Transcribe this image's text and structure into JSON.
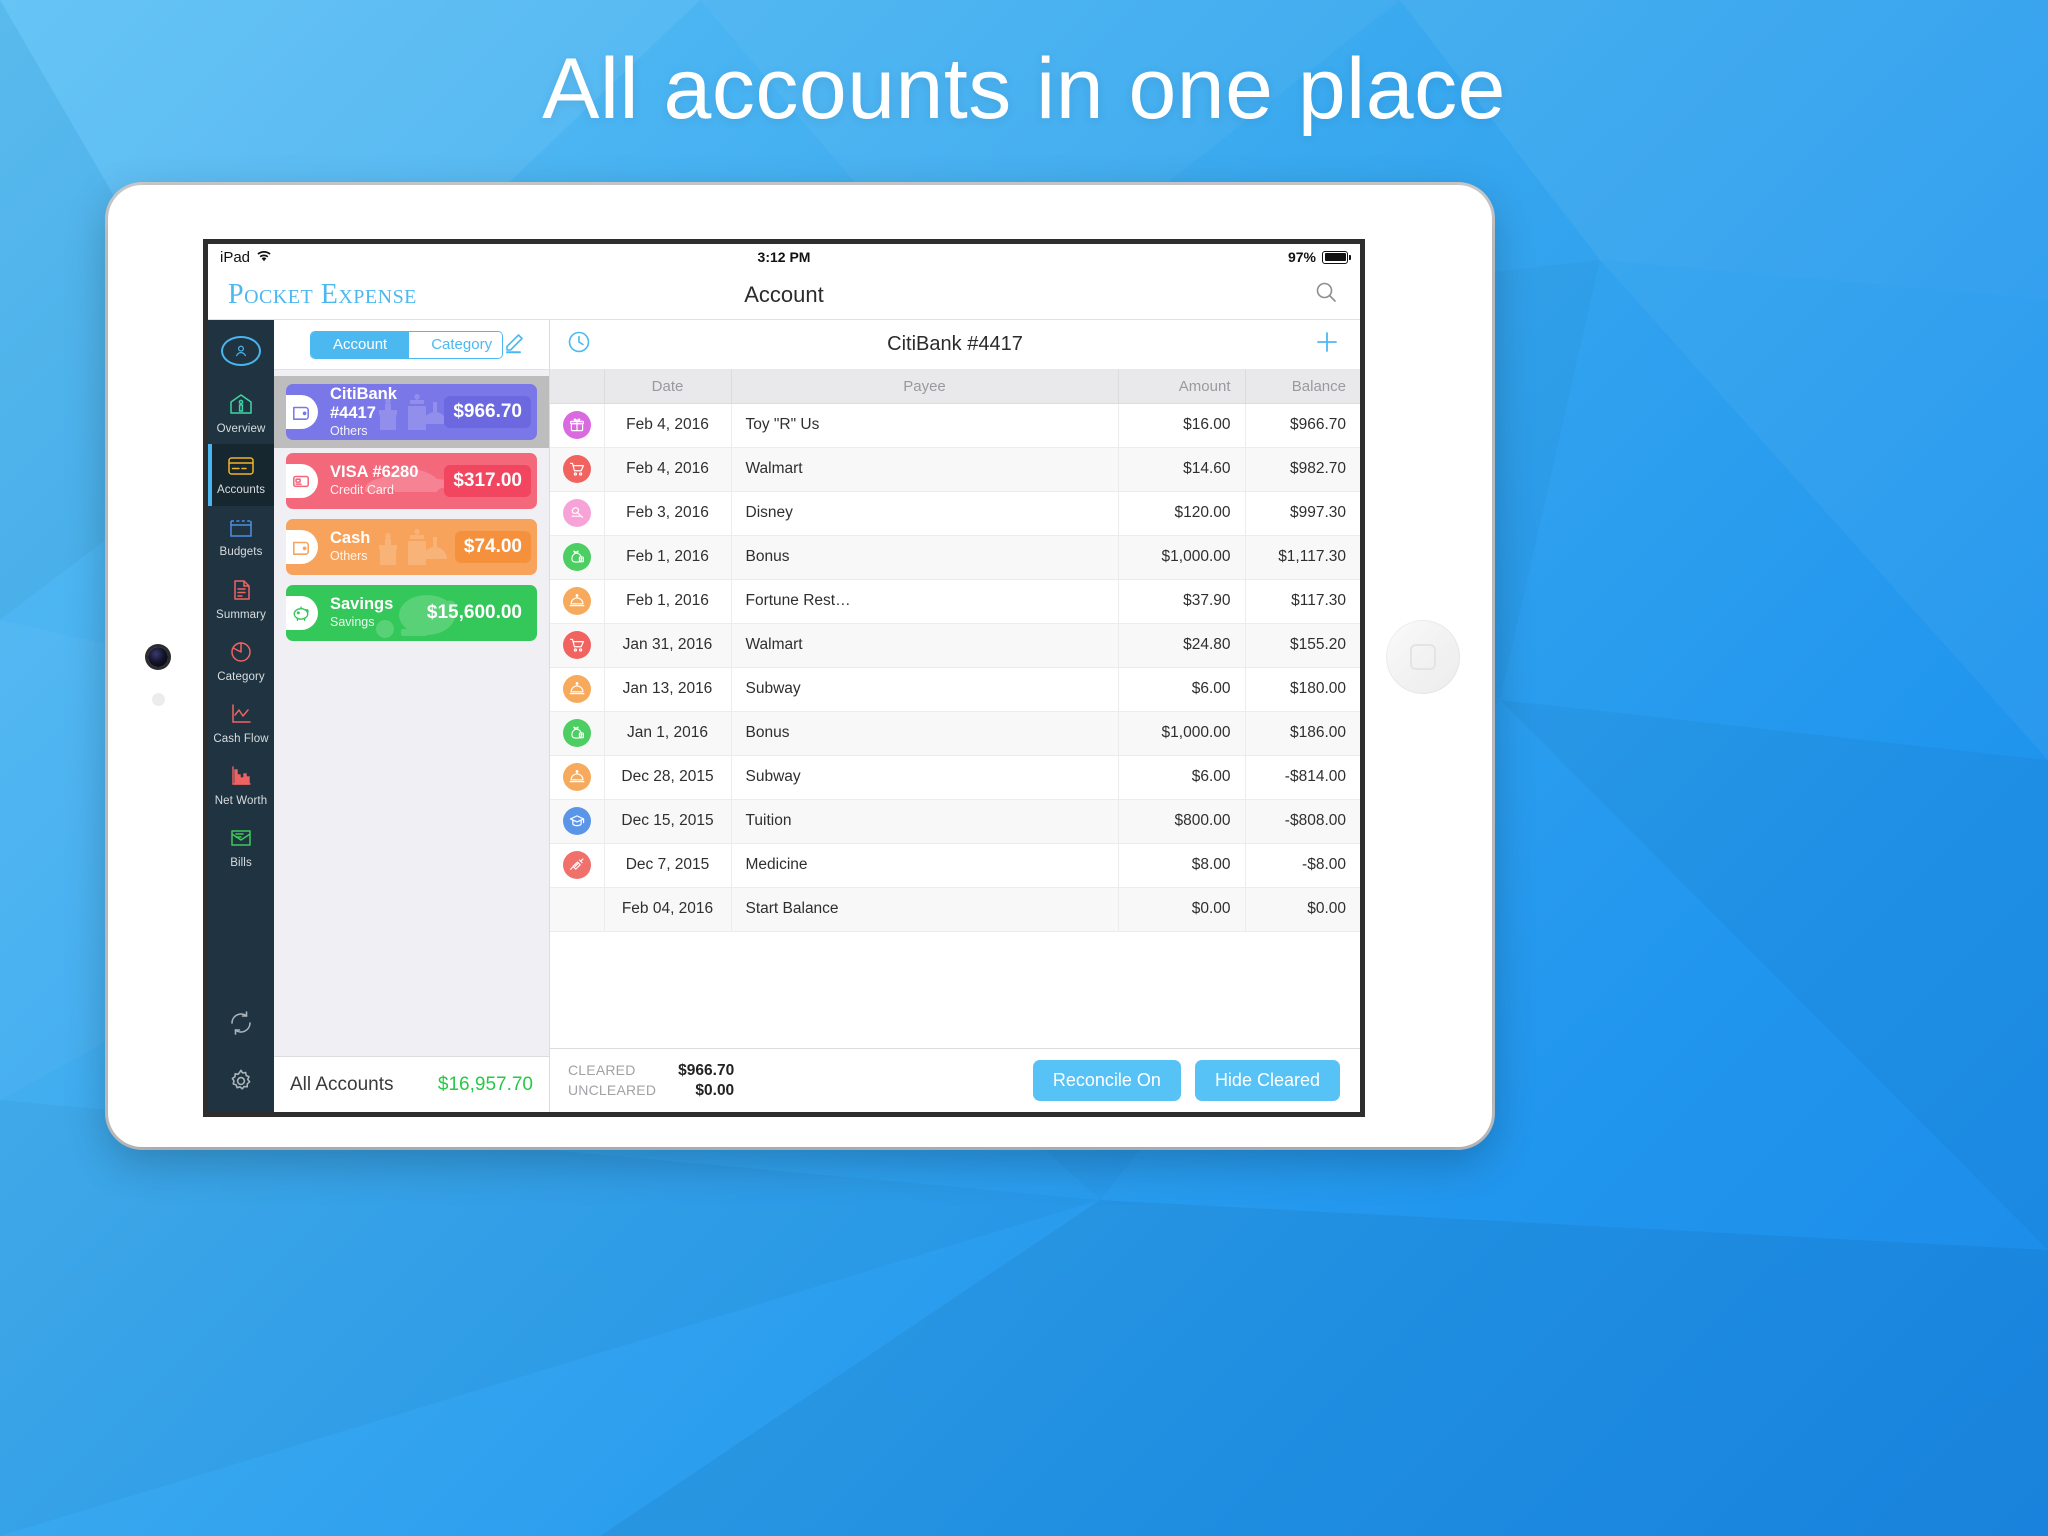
{
  "headline": "All accounts in one place",
  "theme": {
    "accent": "#4cb8f0",
    "sidebar_bg": "#1f3440",
    "positive": "#23cc3f",
    "negative": "#ff3b30"
  },
  "status_bar": {
    "device": "iPad",
    "wifi_icon": "wifi-icon",
    "time": "3:12 PM",
    "battery_percent": "97%",
    "battery_icon": "battery-icon"
  },
  "navbar": {
    "brand": "Pocket Expense",
    "title": "Account",
    "search_icon": "search-icon"
  },
  "sidebar": {
    "avatar_icon": "user-avatar-icon",
    "items": [
      {
        "label": "Overview",
        "icon": "home-icon",
        "color": "#3ed6a4",
        "active": false
      },
      {
        "label": "Accounts",
        "icon": "credit-card-icon",
        "color": "#f0b429",
        "active": true
      },
      {
        "label": "Budgets",
        "icon": "budget-box-icon",
        "color": "#4a90e2",
        "active": false
      },
      {
        "label": "Summary",
        "icon": "documents-icon",
        "color": "#f06363",
        "active": false
      },
      {
        "label": "Category",
        "icon": "pie-chart-icon",
        "color": "#f06363",
        "active": false
      },
      {
        "label": "Cash Flow",
        "icon": "line-chart-icon",
        "color": "#f06363",
        "active": false
      },
      {
        "label": "Net Worth",
        "icon": "bar-chart-icon",
        "color": "#f06363",
        "active": false
      },
      {
        "label": "Bills",
        "icon": "envelope-icon",
        "color": "#3ec95c",
        "active": false
      }
    ],
    "bottom": [
      {
        "icon": "sync-icon"
      },
      {
        "icon": "gear-icon"
      }
    ]
  },
  "accounts_pane": {
    "segmented": {
      "options": [
        "Account",
        "Category"
      ],
      "selected": "Account"
    },
    "edit_icon": "pencil-edit-icon",
    "cards": [
      {
        "name": "CitiBank #4417",
        "type": "Others",
        "amount": "$966.70",
        "color": "#7a77e8",
        "amount_bg": "#6b68e0",
        "icon": "wallet-icon",
        "art": "gifts-art",
        "selected": true
      },
      {
        "name": "VISA #6280",
        "type": "Credit Card",
        "amount": "$317.00",
        "color": "#f4687c",
        "amount_bg": "#f2455f",
        "icon": "card-icon",
        "art": "car-art",
        "selected": false
      },
      {
        "name": "Cash",
        "type": "Others",
        "amount": "$74.00",
        "color": "#f7a35c",
        "amount_bg": "#f5913c",
        "icon": "wallet-icon",
        "art": "gifts-art",
        "selected": false
      },
      {
        "name": "Savings",
        "type": "Savings",
        "amount": "$15,600.00",
        "color": "#34c759",
        "amount_bg": "#34c759",
        "icon": "piggy-icon",
        "art": "piggy-art",
        "selected": false
      }
    ],
    "footer": {
      "label": "All Accounts",
      "amount": "$16,957.70"
    }
  },
  "transactions_pane": {
    "history_icon": "clock-history-icon",
    "title": "CitiBank #4417",
    "add_icon": "plus-icon",
    "columns": [
      "",
      "Date",
      "Payee",
      "Amount",
      "Balance"
    ],
    "rows": [
      {
        "icon": "gift-icon",
        "icon_color": "#d96ae0",
        "date": "Feb 4, 2016",
        "payee": "Toy \"R\" Us",
        "amount": "$16.00",
        "amount_sign": "neg",
        "balance": "$966.70",
        "balance_sign": ""
      },
      {
        "icon": "cart-icon",
        "icon_color": "#f0635e",
        "date": "Feb 4, 2016",
        "payee": "Walmart",
        "amount": "$14.60",
        "amount_sign": "neg",
        "balance": "$982.70",
        "balance_sign": ""
      },
      {
        "icon": "mouse-icon",
        "icon_color": "#f7a3d8",
        "date": "Feb 3, 2016",
        "payee": "Disney",
        "amount": "$120.00",
        "amount_sign": "neg",
        "balance": "$997.30",
        "balance_sign": ""
      },
      {
        "icon": "money-bag-icon",
        "icon_color": "#4cce62",
        "date": "Feb 1, 2016",
        "payee": "Bonus",
        "amount": "$1,000.00",
        "amount_sign": "pos",
        "balance": "$1,117.30",
        "balance_sign": ""
      },
      {
        "icon": "dish-icon",
        "icon_color": "#f7a95c",
        "date": "Feb 1, 2016",
        "payee": "Fortune Rest…",
        "amount": "$37.90",
        "amount_sign": "neg",
        "balance": "$117.30",
        "balance_sign": ""
      },
      {
        "icon": "cart-icon",
        "icon_color": "#f0635e",
        "date": "Jan 31, 2016",
        "payee": "Walmart",
        "amount": "$24.80",
        "amount_sign": "neg",
        "balance": "$155.20",
        "balance_sign": ""
      },
      {
        "icon": "dish-icon",
        "icon_color": "#f7a95c",
        "date": "Jan 13, 2016",
        "payee": "Subway",
        "amount": "$6.00",
        "amount_sign": "neg",
        "balance": "$180.00",
        "balance_sign": ""
      },
      {
        "icon": "money-bag-icon",
        "icon_color": "#4cce62",
        "date": "Jan 1, 2016",
        "payee": "Bonus",
        "amount": "$1,000.00",
        "amount_sign": "pos",
        "balance": "$186.00",
        "balance_sign": ""
      },
      {
        "icon": "dish-icon",
        "icon_color": "#f7a95c",
        "date": "Dec 28, 2015",
        "payee": "Subway",
        "amount": "$6.00",
        "amount_sign": "neg",
        "balance": "-$814.00",
        "balance_sign": "neg"
      },
      {
        "icon": "graduation-icon",
        "icon_color": "#5b95e8",
        "date": "Dec 15, 2015",
        "payee": "Tuition",
        "amount": "$800.00",
        "amount_sign": "neg",
        "balance": "-$808.00",
        "balance_sign": "neg"
      },
      {
        "icon": "syringe-icon",
        "icon_color": "#f0706b",
        "date": "Dec 7, 2015",
        "payee": "Medicine",
        "amount": "$8.00",
        "amount_sign": "neg",
        "balance": "-$8.00",
        "balance_sign": "neg"
      },
      {
        "icon": "",
        "icon_color": "",
        "date": "Feb 04, 2016",
        "payee": "Start Balance",
        "amount": "$0.00",
        "amount_sign": "",
        "balance": "$0.00",
        "balance_sign": ""
      }
    ],
    "footer": {
      "cleared_label": "CLEARED",
      "cleared_value": "$966.70",
      "uncleared_label": "UNCLEARED",
      "uncleared_value": "$0.00",
      "reconcile_button": "Reconcile On",
      "hide_cleared_button": "Hide Cleared"
    }
  }
}
